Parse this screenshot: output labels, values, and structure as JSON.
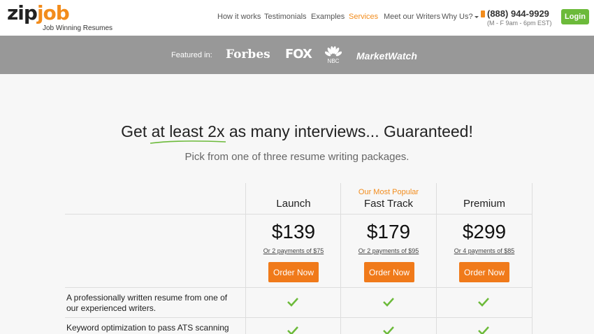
{
  "brand": {
    "logo_zip": "zip",
    "logo_job": "job",
    "tagline": "Job Winning Resumes",
    "accent": "#f28c1c"
  },
  "nav": {
    "items": [
      {
        "label": "How it works",
        "active": false
      },
      {
        "label": "Testimonials",
        "active": false
      },
      {
        "label": "Examples",
        "active": false
      },
      {
        "label": "Services",
        "active": true
      },
      {
        "label": "Meet our Writers",
        "active": false
      },
      {
        "label": "Why Us?",
        "active": false,
        "has_caret": true
      }
    ],
    "phone": "(888) 944-9929",
    "hours": "(M - F 9am - 6pm EST)",
    "login_label": "Login",
    "login_color": "#6cba3a"
  },
  "featured": {
    "label": "Featured in:",
    "logos": [
      "Forbes",
      "FOX",
      "NBC",
      "MarketWatch"
    ]
  },
  "hero": {
    "headline": "Get at least 2x as many interviews... Guaranteed!",
    "subhead": "Pick from one of three resume writing packages."
  },
  "pricing": {
    "popular_label": "Our Most Popular",
    "plans": [
      {
        "name": "Launch",
        "price": "$139",
        "payment": "Or 2 payments of $75",
        "cta": "Order Now"
      },
      {
        "name": "Fast Track",
        "price": "$179",
        "payment": "Or 2 payments of $95",
        "cta": "Order Now"
      },
      {
        "name": "Premium",
        "price": "$299",
        "payment": "Or 4 payments of $85",
        "cta": "Order Now"
      }
    ],
    "features": [
      {
        "line1": "A professionally written resume from one of",
        "line2": "our experienced writers.",
        "included": [
          true,
          true,
          true
        ]
      },
      {
        "line1": "Keyword optimization to pass ATS scanning",
        "line2": "",
        "included": [
          true,
          true,
          true
        ]
      }
    ],
    "check_color": "#6cba3a",
    "cta_color": "#f07a1a"
  }
}
